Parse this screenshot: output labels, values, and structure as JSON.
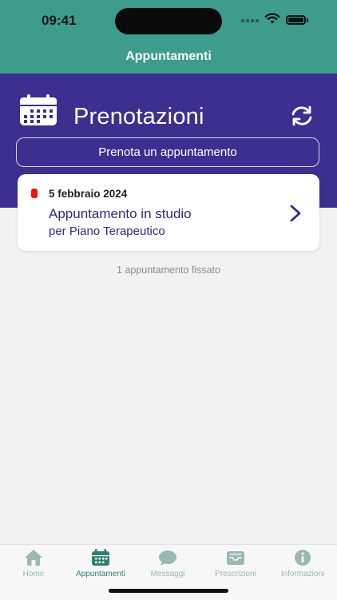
{
  "status_bar": {
    "time": "09:41"
  },
  "nav": {
    "title": "Appuntamenti"
  },
  "header": {
    "title": "Prenotazioni",
    "book_button": "Prenota un appuntamento"
  },
  "appointment": {
    "date": "5 febbraio 2024",
    "title": "Appuntamento in studio",
    "subtitle": "per Piano Terapeutico",
    "status_color": "#e8160c"
  },
  "count_text": "1 appuntamento fissato",
  "tabs": [
    {
      "label": "Home",
      "icon": "home-icon",
      "active": false
    },
    {
      "label": "Appuntamenti",
      "icon": "calendar-icon",
      "active": true
    },
    {
      "label": "Messaggi",
      "icon": "chat-icon",
      "active": false
    },
    {
      "label": "Prescrizioni",
      "icon": "inbox-icon",
      "active": false
    },
    {
      "label": "Informazioni",
      "icon": "info-icon",
      "active": false
    }
  ],
  "colors": {
    "teal": "#3d9c8b",
    "purple": "#3c2f8f",
    "accent_text": "#35297e"
  }
}
